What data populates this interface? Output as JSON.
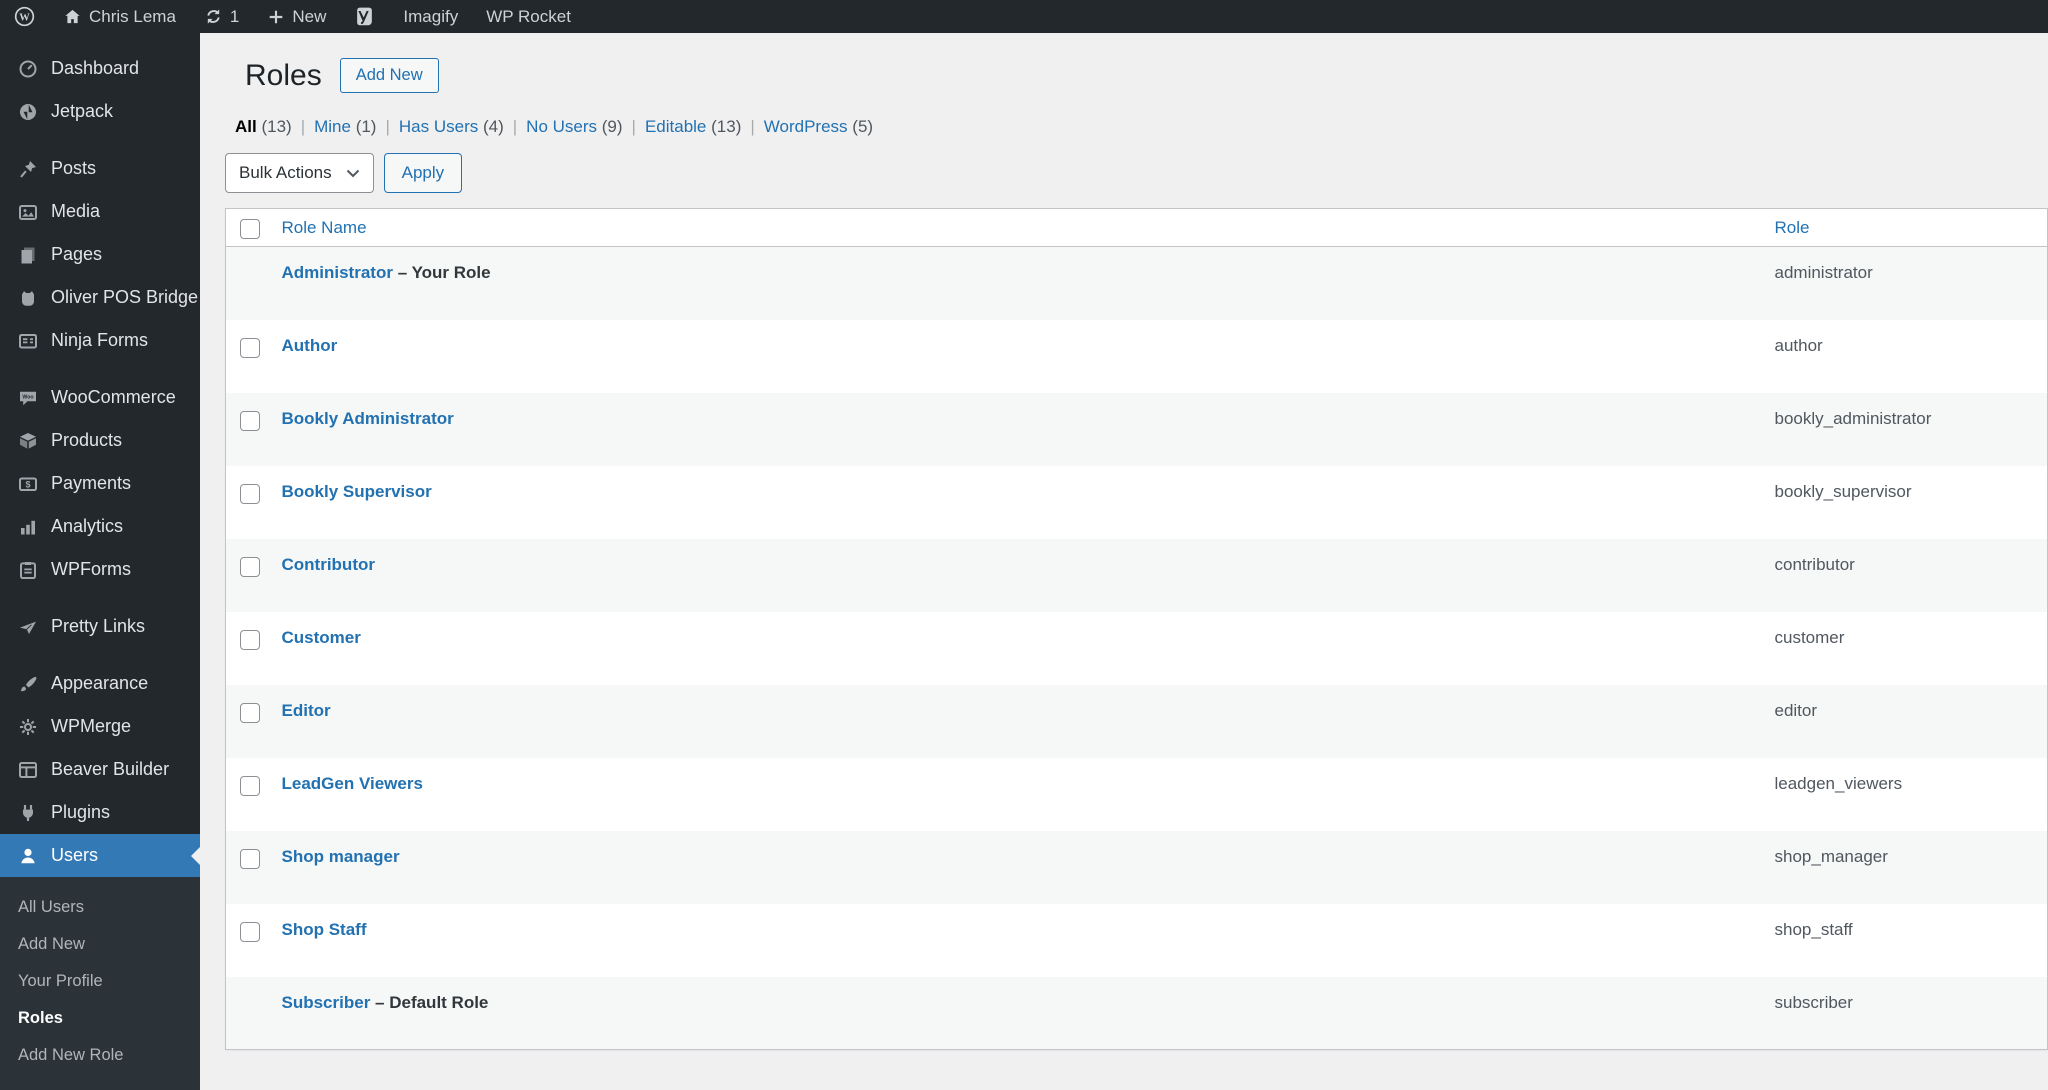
{
  "admin_bar": {
    "site_name": "Chris Lema",
    "updates_count": "1",
    "new_label": "New",
    "imagify_label": "Imagify",
    "wp_rocket_label": "WP Rocket"
  },
  "sidebar": {
    "items": [
      {
        "label": "Dashboard",
        "icon": "dashboard"
      },
      {
        "label": "Jetpack",
        "icon": "jetpack"
      },
      {
        "type": "separator"
      },
      {
        "label": "Posts",
        "icon": "pin"
      },
      {
        "label": "Media",
        "icon": "media"
      },
      {
        "label": "Pages",
        "icon": "pages"
      },
      {
        "label": "Oliver POS Bridge",
        "icon": "oliver-pos"
      },
      {
        "label": "Ninja Forms",
        "icon": "ninja-forms"
      },
      {
        "type": "separator"
      },
      {
        "label": "WooCommerce",
        "icon": "woocommerce"
      },
      {
        "label": "Products",
        "icon": "products"
      },
      {
        "label": "Payments",
        "icon": "payments"
      },
      {
        "label": "Analytics",
        "icon": "analytics"
      },
      {
        "label": "WPForms",
        "icon": "wpforms"
      },
      {
        "type": "separator"
      },
      {
        "label": "Pretty Links",
        "icon": "pretty-links"
      },
      {
        "type": "separator"
      },
      {
        "label": "Appearance",
        "icon": "appearance"
      },
      {
        "label": "WPMerge",
        "icon": "gear"
      },
      {
        "label": "Beaver Builder",
        "icon": "beaver-builder"
      },
      {
        "label": "Plugins",
        "icon": "plugins"
      },
      {
        "label": "Users",
        "icon": "users",
        "active": true
      }
    ],
    "submenu": {
      "items": [
        {
          "label": "All Users"
        },
        {
          "label": "Add New"
        },
        {
          "label": "Your Profile"
        },
        {
          "label": "Roles",
          "current": true
        },
        {
          "label": "Add New Role"
        }
      ]
    }
  },
  "page": {
    "title": "Roles",
    "add_new_label": "Add New"
  },
  "filters": [
    {
      "label": "All",
      "count": "(13)",
      "active": true
    },
    {
      "label": "Mine",
      "count": "(1)"
    },
    {
      "label": "Has Users",
      "count": "(4)"
    },
    {
      "label": "No Users",
      "count": "(9)"
    },
    {
      "label": "Editable",
      "count": "(13)"
    },
    {
      "label": "WordPress",
      "count": "(5)"
    }
  ],
  "bulk_actions": {
    "select_label": "Bulk Actions",
    "apply_label": "Apply"
  },
  "table": {
    "headers": {
      "name": "Role Name",
      "role": "Role"
    },
    "rows": [
      {
        "name": "Administrator",
        "suffix": "– Your Role",
        "role": "administrator",
        "checkbox": false
      },
      {
        "name": "Author",
        "suffix": "",
        "role": "author",
        "checkbox": true
      },
      {
        "name": "Bookly Administrator",
        "suffix": "",
        "role": "bookly_administrator",
        "checkbox": true
      },
      {
        "name": "Bookly Supervisor",
        "suffix": "",
        "role": "bookly_supervisor",
        "checkbox": true
      },
      {
        "name": "Contributor",
        "suffix": "",
        "role": "contributor",
        "checkbox": true
      },
      {
        "name": "Customer",
        "suffix": "",
        "role": "customer",
        "checkbox": true
      },
      {
        "name": "Editor",
        "suffix": "",
        "role": "editor",
        "checkbox": true
      },
      {
        "name": "LeadGen Viewers",
        "suffix": "",
        "role": "leadgen_viewers",
        "checkbox": true
      },
      {
        "name": "Shop manager",
        "suffix": "",
        "role": "shop_manager",
        "checkbox": true
      },
      {
        "name": "Shop Staff",
        "suffix": "",
        "role": "shop_staff",
        "checkbox": true
      },
      {
        "name": "Subscriber",
        "suffix": "– Default Role",
        "role": "subscriber",
        "checkbox": false
      }
    ]
  },
  "colors": {
    "accent_link": "#2271b1",
    "menu_active": "#3379b5",
    "admin_dark": "#23282d",
    "row_stripe": "#f6f7f7",
    "content_bg": "#f0f0f1"
  }
}
